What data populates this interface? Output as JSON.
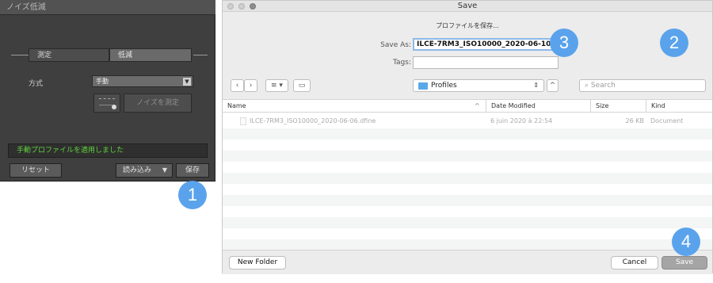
{
  "left_panel": {
    "title": "ノイズ低減",
    "tabs": [
      "測定",
      "低減"
    ],
    "method_label": "方式",
    "method_value": "手動",
    "measure_button": "ノイズを測定",
    "status": "手動プロファイルを適用しました",
    "reset_button": "リセット",
    "load_button": "読み込み",
    "save_button": "保存"
  },
  "badges": {
    "b1": "1",
    "b2": "2",
    "b3": "3",
    "b4": "4"
  },
  "dialog": {
    "title": "Save",
    "subtitle": "プロファイルを保存...",
    "save_as_label": "Save As:",
    "save_as_value": "ILCE-7RM3_ISO10000_2020-06-10",
    "tags_label": "Tags:",
    "tags_value": "",
    "location": "Profiles",
    "search_placeholder": "Search",
    "columns": {
      "name": "Name",
      "date": "Date Modified",
      "size": "Size",
      "kind": "Kind"
    },
    "files": [
      {
        "name": "ILCE-7RM3_ISO10000_2020-06-06.dfine",
        "date": "6 juin 2020 à 22:54",
        "size": "26 KB",
        "kind": "Document"
      }
    ],
    "new_folder_button": "New Folder",
    "cancel_button": "Cancel",
    "save_button": "Save"
  },
  "colors": {
    "accent_badge": "#5aa3ec",
    "status_green": "#5fd23b"
  }
}
